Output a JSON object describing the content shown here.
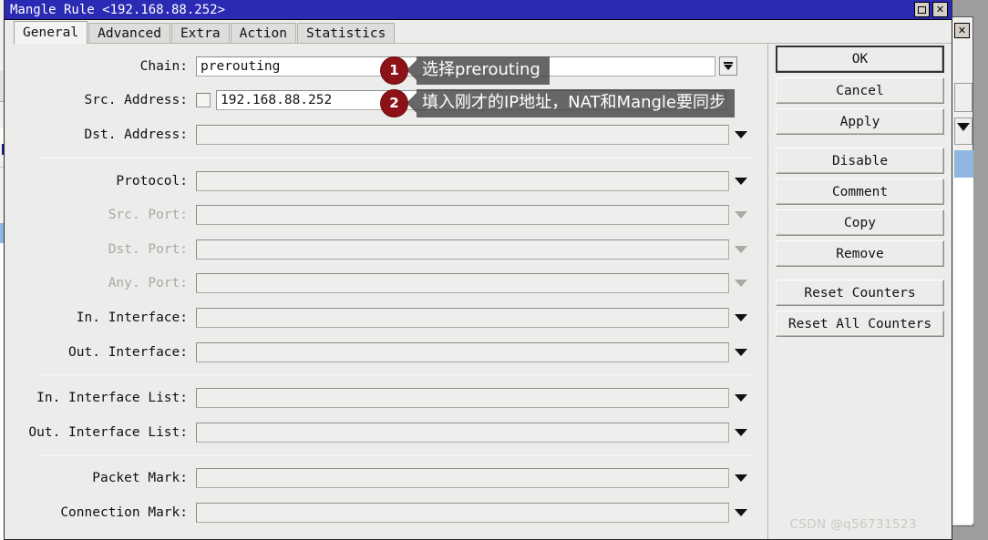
{
  "window": {
    "title": "Mangle Rule <192.168.88.252>",
    "controls": [
      {
        "name": "maximize",
        "glyph": "□"
      },
      {
        "name": "close",
        "glyph": "✕"
      }
    ]
  },
  "tabs": [
    {
      "label": "General",
      "active": true
    },
    {
      "label": "Advanced",
      "active": false
    },
    {
      "label": "Extra",
      "active": false
    },
    {
      "label": "Action",
      "active": false
    },
    {
      "label": "Statistics",
      "active": false
    }
  ],
  "form": {
    "rows": [
      {
        "label": "Chain:",
        "value": "prerouting",
        "enabled": true,
        "filled": true,
        "checkbox": false,
        "control": "dropbutton"
      },
      {
        "label": "Src. Address:",
        "value": "192.168.88.252",
        "enabled": true,
        "filled": true,
        "checkbox": true,
        "control": "none"
      },
      {
        "label": "Dst. Address:",
        "value": "",
        "enabled": true,
        "filled": false,
        "checkbox": false,
        "control": "caret"
      },
      {
        "label": "Protocol:",
        "value": "",
        "enabled": true,
        "filled": false,
        "checkbox": false,
        "control": "caret"
      },
      {
        "label": "Src. Port:",
        "value": "",
        "enabled": false,
        "filled": false,
        "checkbox": false,
        "control": "caret"
      },
      {
        "label": "Dst. Port:",
        "value": "",
        "enabled": false,
        "filled": false,
        "checkbox": false,
        "control": "caret"
      },
      {
        "label": "Any. Port:",
        "value": "",
        "enabled": false,
        "filled": false,
        "checkbox": false,
        "control": "caret"
      },
      {
        "label": "In. Interface:",
        "value": "",
        "enabled": true,
        "filled": false,
        "checkbox": false,
        "control": "caret"
      },
      {
        "label": "Out. Interface:",
        "value": "",
        "enabled": true,
        "filled": false,
        "checkbox": false,
        "control": "caret"
      },
      {
        "label": "In. Interface List:",
        "value": "",
        "enabled": true,
        "filled": false,
        "checkbox": false,
        "control": "caret"
      },
      {
        "label": "Out. Interface List:",
        "value": "",
        "enabled": true,
        "filled": false,
        "checkbox": false,
        "control": "caret"
      },
      {
        "label": "Packet Mark:",
        "value": "",
        "enabled": true,
        "filled": false,
        "checkbox": false,
        "control": "caret"
      },
      {
        "label": "Connection Mark:",
        "value": "",
        "enabled": true,
        "filled": false,
        "checkbox": false,
        "control": "caret"
      }
    ]
  },
  "buttons": [
    {
      "label": "OK",
      "primary": true
    },
    {
      "label": "Cancel",
      "primary": false
    },
    {
      "label": "Apply",
      "primary": false
    },
    {
      "label": "Disable",
      "primary": false
    },
    {
      "label": "Comment",
      "primary": false
    },
    {
      "label": "Copy",
      "primary": false
    },
    {
      "label": "Remove",
      "primary": false
    },
    {
      "label": "Reset Counters",
      "primary": false
    },
    {
      "label": "Reset All Counters",
      "primary": false
    }
  ],
  "annotations": [
    {
      "number": "1",
      "text": "选择prerouting"
    },
    {
      "number": "2",
      "text": "填入刚才的IP地址，NAT和Mangle要同步"
    }
  ],
  "watermark": "CSDN @q56731523",
  "colors": {
    "titlebar": "#2a2ab4",
    "badge": "#8c1218",
    "tooltip": "rgba(70,70,70,0.82)",
    "dialog_bg": "#ececeb"
  }
}
